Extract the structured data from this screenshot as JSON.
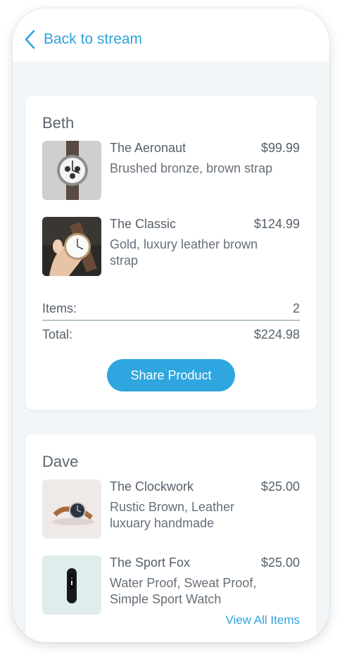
{
  "nav": {
    "back_label": "Back to stream",
    "back_icon": "chevron-left-icon"
  },
  "colors": {
    "accent": "#2fa3dc",
    "button": "#2fa6df",
    "background": "#f3f6f9",
    "text": "#56606a"
  },
  "orders": [
    {
      "name": "Beth",
      "items": [
        {
          "title": "The Aeronaut",
          "price": "$99.99",
          "description": "Brushed bronze, brown strap",
          "image": "watch-photo"
        },
        {
          "title": "The Classic",
          "price": "$124.99",
          "description": "Gold, luxury leather brown strap",
          "image": "watch-in-hand-photo"
        }
      ],
      "items_label": "Items:",
      "items_count": "2",
      "total_label": "Total:",
      "total_value": "$224.98",
      "share_label": "Share Product"
    },
    {
      "name": "Dave",
      "items": [
        {
          "title": "The Clockwork",
          "price": "$25.00",
          "description": "Rustic Brown, Leather luxuary handmade",
          "image": "watch-photo"
        },
        {
          "title": "The Sport Fox",
          "price": "$25.00",
          "description": "Water Proof, Sweat Proof, Simple Sport Watch",
          "image": "fitness-band-photo"
        }
      ],
      "view_all_label": "View All Items"
    }
  ]
}
